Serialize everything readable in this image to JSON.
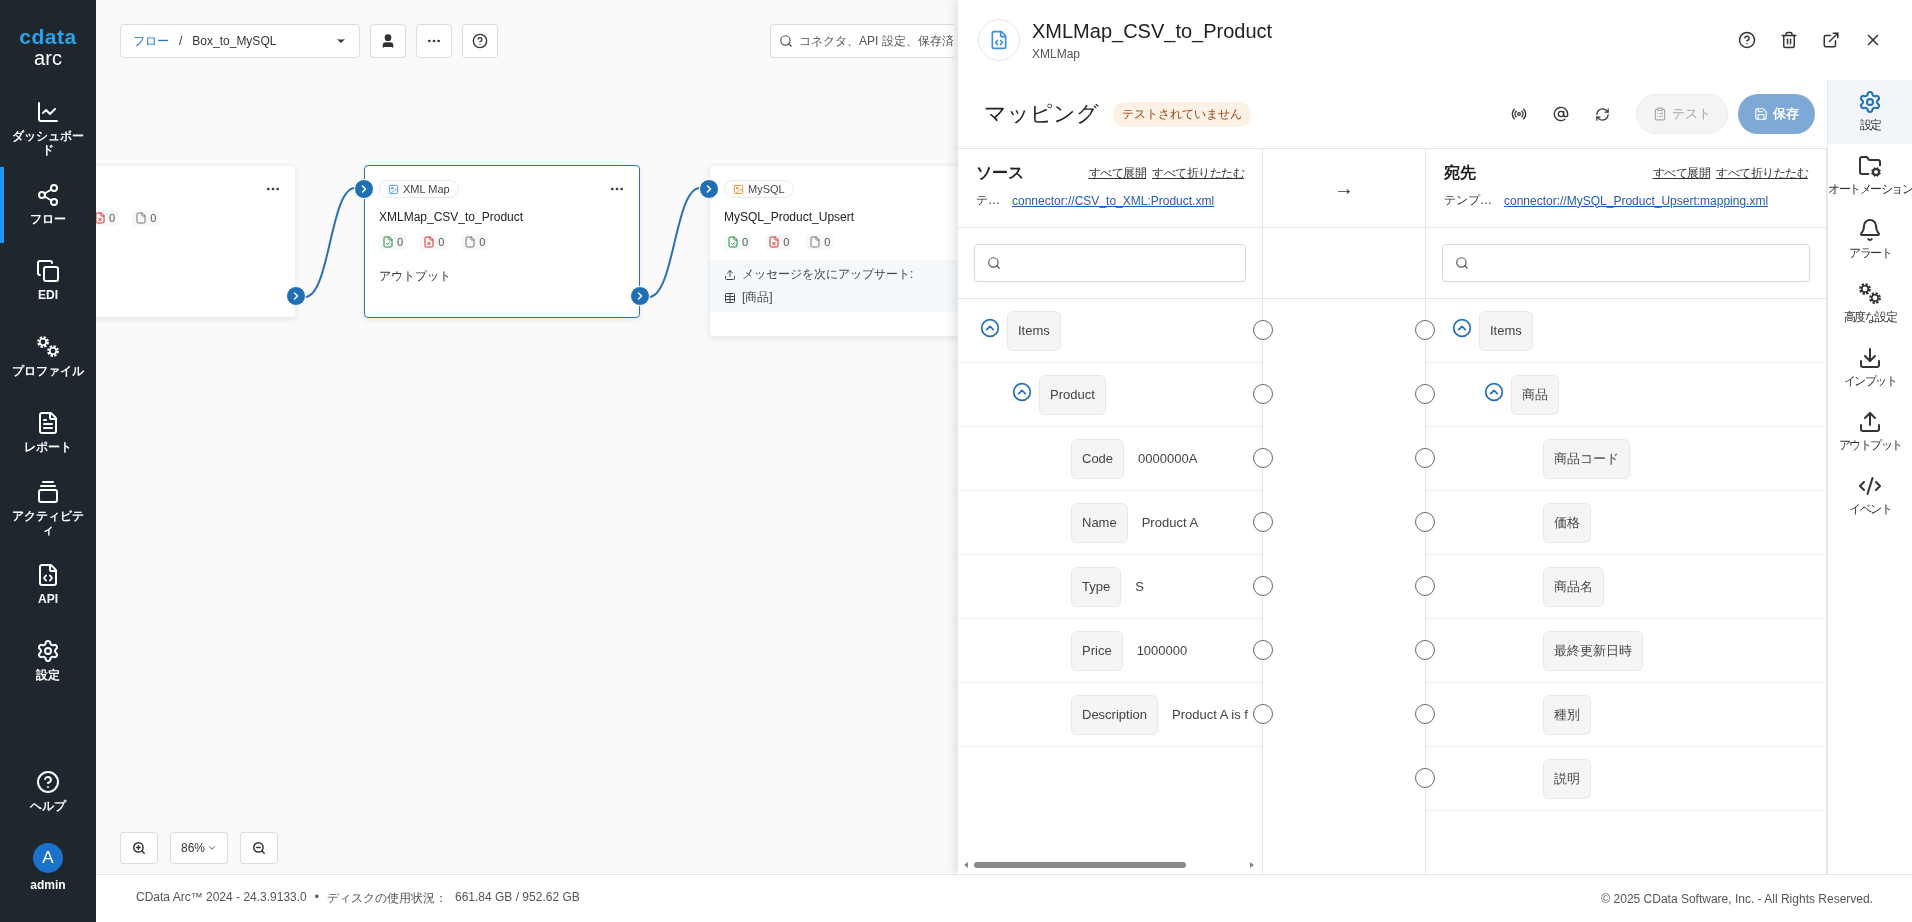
{
  "sidebar": {
    "logo": {
      "wordmark": "cdata",
      "product": "arc"
    },
    "items": [
      {
        "kind": "dashboard",
        "label": "ダッシュボード",
        "selected": false
      },
      {
        "kind": "flow",
        "label": "フロー",
        "selected": true
      },
      {
        "kind": "edi",
        "label": "EDI",
        "selected": false
      },
      {
        "kind": "profile",
        "label": "プロファイル",
        "selected": false
      },
      {
        "kind": "report",
        "label": "レポート",
        "selected": false
      },
      {
        "kind": "activity",
        "label": "アクティビティ",
        "selected": false
      },
      {
        "kind": "api",
        "label": "API",
        "selected": false
      },
      {
        "kind": "settings",
        "label": "設定",
        "selected": false
      }
    ],
    "bottom": [
      {
        "kind": "help",
        "label": "ヘルプ"
      },
      {
        "kind": "user",
        "label": "admin",
        "initial": "A"
      }
    ]
  },
  "toolbar": {
    "breadcrumb": {
      "root": "フロー",
      "separator": "/",
      "current": "Box_to_MySQL"
    },
    "search": {
      "placeholder": "コネクタ、API 設定、保存済"
    }
  },
  "canvas": {
    "nodes": [
      {
        "selected": false,
        "stats": [
          {
            "kind": "error",
            "count": "0"
          },
          {
            "kind": "queued",
            "count": "0"
          }
        ]
      },
      {
        "kind": "xmlmap",
        "selected": true,
        "label": "XML Map",
        "name": "XMLMap_CSV_to_Product",
        "stats": [
          {
            "kind": "success",
            "count": "0"
          },
          {
            "kind": "error",
            "count": "0"
          },
          {
            "kind": "queued",
            "count": "0"
          }
        ],
        "output_label": "アウトプット"
      },
      {
        "kind": "mysql",
        "selected": false,
        "label": "MySQL",
        "name": "MySQL_Product_Upsert",
        "stats": [
          {
            "kind": "success",
            "count": "0"
          },
          {
            "kind": "error",
            "count": "0"
          },
          {
            "kind": "queued",
            "count": "0"
          }
        ],
        "action": {
          "text": "メッセージを次にアップサート:",
          "table": "[商品]"
        }
      }
    ],
    "zoom": {
      "value": "86%"
    }
  },
  "panel": {
    "title": "XMLMap_CSV_to_Product",
    "subtitle": "XMLMap",
    "section": {
      "title": "マッピング",
      "status": "テストされていません",
      "test_button": {
        "label": "テスト",
        "disabled": true
      },
      "save_button": {
        "label": "保存",
        "disabled": true
      }
    },
    "source": {
      "title": "ソース",
      "expand_all": "すべて展開",
      "collapse_all": "すべて折りたたむ",
      "template_label": "テ…",
      "template_link": "connector://CSV_to_XML:Product.xml",
      "tree": [
        {
          "label": "Items",
          "expanded": true,
          "children": [
            {
              "label": "Product",
              "expanded": true,
              "children": [
                {
                  "label": "Code",
                  "value": "0000000A"
                },
                {
                  "label": "Name",
                  "value": "Product A"
                },
                {
                  "label": "Type",
                  "value": "S"
                },
                {
                  "label": "Price",
                  "value": "1000000"
                },
                {
                  "label": "Description",
                  "value": "Product A is f"
                }
              ]
            }
          ]
        }
      ]
    },
    "arrow": "→",
    "target": {
      "title": "宛先",
      "expand_all": "すべて展開",
      "collapse_all": "すべて折りたたむ",
      "template_label": "テンプ…",
      "template_link": "connector://MySQL_Product_Upsert:mapping.xml",
      "tree": [
        {
          "label": "Items",
          "expanded": true,
          "children": [
            {
              "label": "商品",
              "expanded": true,
              "children": [
                {
                  "label": "商品コード"
                },
                {
                  "label": "価格"
                },
                {
                  "label": "商品名"
                },
                {
                  "label": "最終更新日時"
                },
                {
                  "label": "種別"
                },
                {
                  "label": "説明"
                }
              ]
            }
          ]
        }
      ]
    },
    "rail": [
      {
        "kind": "settings",
        "label": "設定",
        "selected": true
      },
      {
        "kind": "automation",
        "label": "オートメーション",
        "selected": false
      },
      {
        "kind": "alert",
        "label": "アラート",
        "selected": false
      },
      {
        "kind": "advanced",
        "label": "高度な設定",
        "selected": false
      },
      {
        "kind": "input",
        "label": "インプット",
        "selected": false
      },
      {
        "kind": "output",
        "label": "アウトプット",
        "selected": false
      },
      {
        "kind": "event",
        "label": "イベント",
        "selected": false
      }
    ]
  },
  "footer": {
    "version": "CData Arc™ 2024 - 24.3.9133.0",
    "separator": "•",
    "disk_label": "ディスクの使用状況：",
    "disk_value": "661.84 GB / 952.62 GB",
    "copyright": "© 2025 CData Software, Inc. - All Rights Reserved."
  }
}
